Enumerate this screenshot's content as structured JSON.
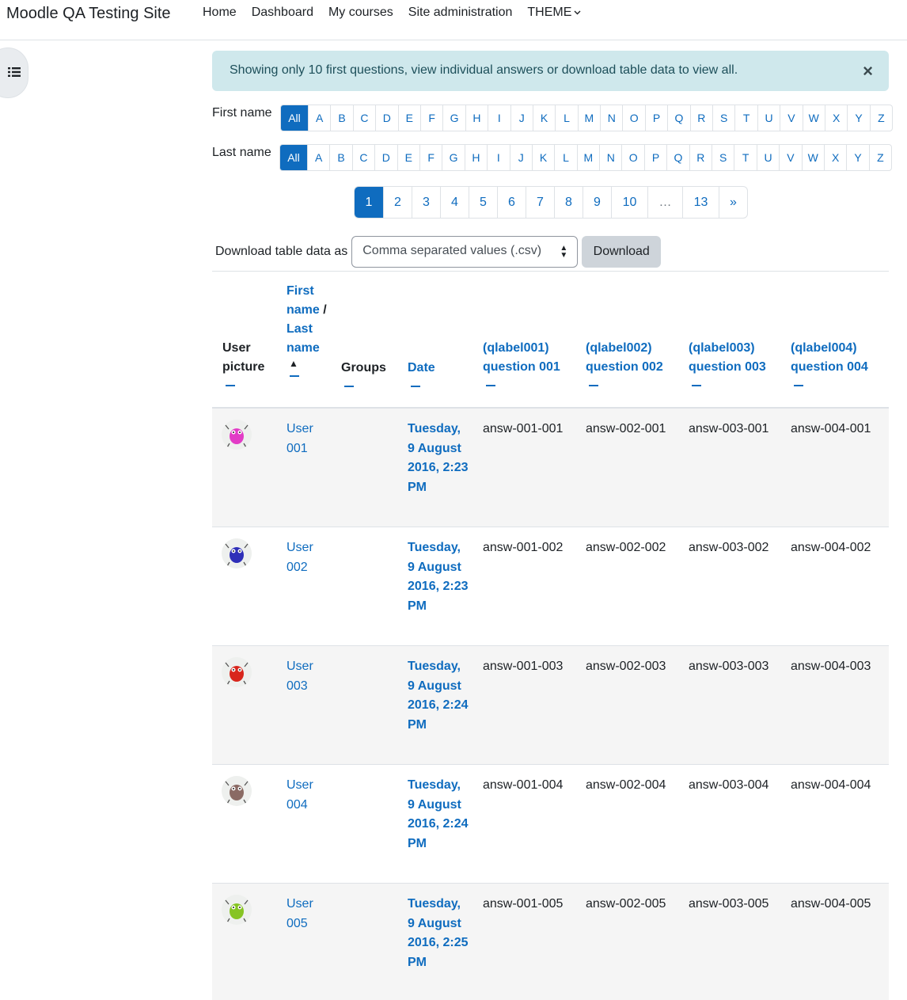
{
  "navbar": {
    "brand": "Moodle QA Testing Site",
    "items": [
      {
        "label": "Home"
      },
      {
        "label": "Dashboard"
      },
      {
        "label": "My courses"
      },
      {
        "label": "Site administration"
      },
      {
        "label": "THEME",
        "has_dropdown": true
      }
    ]
  },
  "drawer_toggle": {
    "icon": "list-icon"
  },
  "alert": {
    "text": "Showing only 10 first questions, view individual answers or download table data to view all.",
    "close": "×"
  },
  "initials": {
    "first": {
      "label": "First name",
      "all": "All"
    },
    "last": {
      "label": "Last name",
      "all": "All"
    },
    "letters": [
      "A",
      "B",
      "C",
      "D",
      "E",
      "F",
      "G",
      "H",
      "I",
      "J",
      "K",
      "L",
      "M",
      "N",
      "O",
      "P",
      "Q",
      "R",
      "S",
      "T",
      "U",
      "V",
      "W",
      "X",
      "Y",
      "Z"
    ]
  },
  "pagination": {
    "pages": [
      "1",
      "2",
      "3",
      "4",
      "5",
      "6",
      "7",
      "8",
      "9",
      "10",
      "…",
      "13",
      "»"
    ],
    "active": "1"
  },
  "download": {
    "label": "Download table data as",
    "selected": "Comma separated values (.csv)",
    "button": "Download"
  },
  "table": {
    "headers": {
      "picture": "User picture",
      "first_name": "First name",
      "separator": " / ",
      "last_name": "Last name",
      "groups": "Groups",
      "date": "Date",
      "q1_label": "(qlabel001)",
      "q1_name": "question 001",
      "q2_label": "(qlabel002)",
      "q2_name": "question 002",
      "q3_label": "(qlabel003)",
      "q3_name": "question 003",
      "q4_label": "(qlabel004)",
      "q4_name": "question 004"
    },
    "rows": [
      {
        "name": "User 001",
        "date": "Tuesday, 9 August 2016, 2:23 PM",
        "a1": "answ-001-001",
        "a2": "answ-002-001",
        "a3": "answ-003-001",
        "a4": "answ-004-001",
        "avatar_color": "#e23cc6"
      },
      {
        "name": "User 002",
        "date": "Tuesday, 9 August 2016, 2:23 PM",
        "a1": "answ-001-002",
        "a2": "answ-002-002",
        "a3": "answ-003-002",
        "a4": "answ-004-002",
        "avatar_color": "#2f2fb8"
      },
      {
        "name": "User 003",
        "date": "Tuesday, 9 August 2016, 2:24 PM",
        "a1": "answ-001-003",
        "a2": "answ-002-003",
        "a3": "answ-003-003",
        "a4": "answ-004-003",
        "avatar_color": "#d8261c"
      },
      {
        "name": "User 004",
        "date": "Tuesday, 9 August 2016, 2:24 PM",
        "a1": "answ-001-004",
        "a2": "answ-002-004",
        "a3": "answ-003-004",
        "a4": "answ-004-004",
        "avatar_color": "#8a6a64"
      },
      {
        "name": "User 005",
        "date": "Tuesday, 9 August 2016, 2:25 PM",
        "a1": "answ-001-005",
        "a2": "answ-002-005",
        "a3": "answ-003-005",
        "a4": "answ-004-005",
        "avatar_color": "#86c423"
      }
    ]
  }
}
